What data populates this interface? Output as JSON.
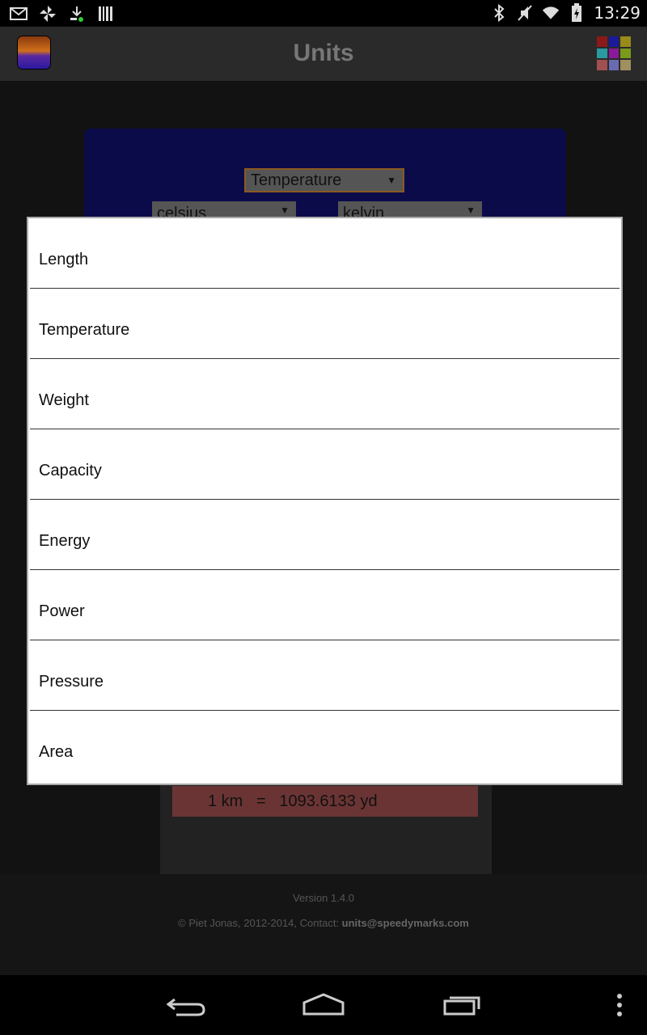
{
  "status_bar": {
    "time": "13:29",
    "left_icons": [
      "gmail-icon",
      "pinwheel-icon",
      "download-icon",
      "barcode-icon"
    ],
    "right_icons": [
      "bluetooth-icon",
      "mute-icon",
      "wifi-icon",
      "battery-icon"
    ]
  },
  "app_bar": {
    "title": "Units"
  },
  "converter": {
    "category_selected": "Temperature",
    "from_unit": "celsius",
    "to_unit": "kelvin",
    "result_text": "1 km   =   1093.6133 yd"
  },
  "dialog": {
    "options": [
      "Length",
      "Temperature",
      "Weight",
      "Capacity",
      "Energy",
      "Power",
      "Pressure",
      "Area"
    ]
  },
  "footer": {
    "version": "Version 1.4.0",
    "credits": "© Piet Jonas, 2012-2014, Contact: ",
    "email": "units@speedymarks.com"
  },
  "colors": {
    "grid_icon": [
      "#8a1a1a",
      "#1a1a9a",
      "#9a8a1a",
      "#2a9aa0",
      "#8a1a9a",
      "#7a9a1a",
      "#a05050",
      "#6a6ab0",
      "#a09060"
    ]
  }
}
